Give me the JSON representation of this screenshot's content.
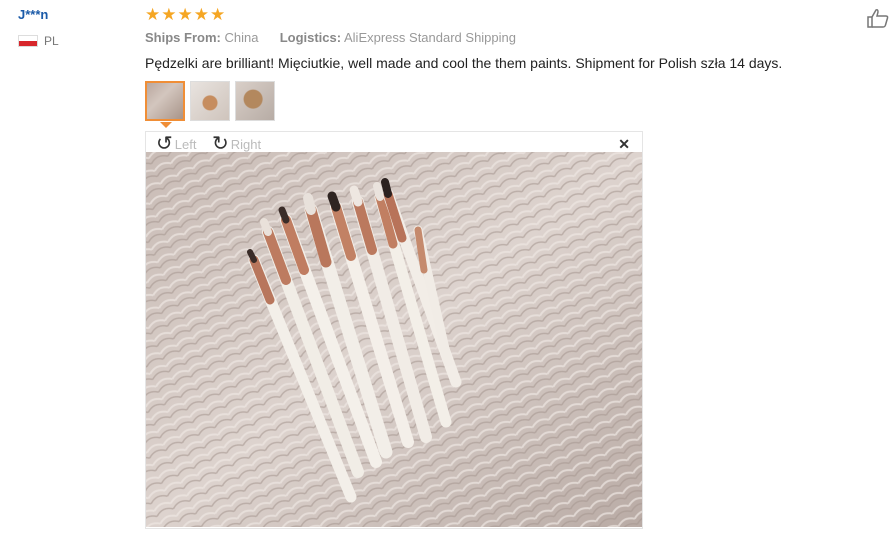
{
  "user": {
    "name": "J***n",
    "country": "PL"
  },
  "rating": {
    "stars": 5,
    "max": 5
  },
  "meta": {
    "ships_from_label": "Ships From:",
    "ships_from_value": "China",
    "logistics_label": "Logistics:",
    "logistics_value": "AliExpress Standard Shipping"
  },
  "review_text": "Pędzelki are brilliant! Mięciutkie, well made and cool the them paints. Shipment for Polish szła 14 days.",
  "viewer": {
    "rotate_left_label": "Left",
    "rotate_right_label": "Right",
    "close_glyph": "✕"
  },
  "icons": {
    "star": "★",
    "rotate_left": "↺",
    "rotate_right": "↻"
  }
}
